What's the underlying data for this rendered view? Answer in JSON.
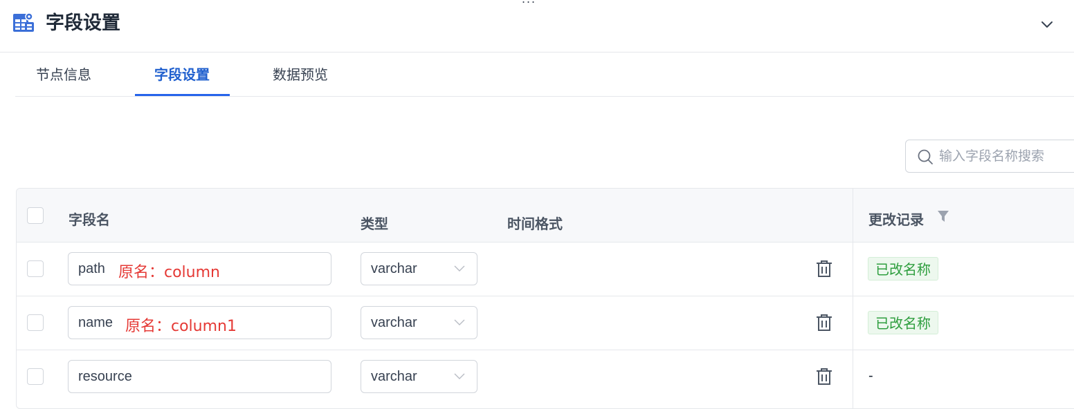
{
  "window": {
    "drag_handle": "···"
  },
  "header": {
    "title": "字段设置",
    "icon": "table-settings-icon",
    "collapse_icon": "chevron-down-icon"
  },
  "tabs": [
    {
      "label": "节点信息",
      "active": false
    },
    {
      "label": "字段设置",
      "active": true
    },
    {
      "label": "数据预览",
      "active": false
    }
  ],
  "search": {
    "placeholder": "输入字段名称搜索",
    "value": ""
  },
  "table": {
    "headers": {
      "field_name": "字段名",
      "type": "类型",
      "time_format": "时间格式",
      "change_log": "更改记录"
    },
    "rows": [
      {
        "field_name": "path",
        "original_name": "原名：column",
        "type": "varchar",
        "change_log": "已改名称"
      },
      {
        "field_name": "name",
        "original_name": "原名：column1",
        "type": "varchar",
        "change_log": "已改名称"
      },
      {
        "field_name": "resource",
        "original_name": "",
        "type": "varchar",
        "change_log": "-"
      }
    ]
  },
  "colors": {
    "accent": "#2563eb",
    "error": "#e53935",
    "success": "#2e9e3e",
    "success_bg": "#edf8ee"
  }
}
